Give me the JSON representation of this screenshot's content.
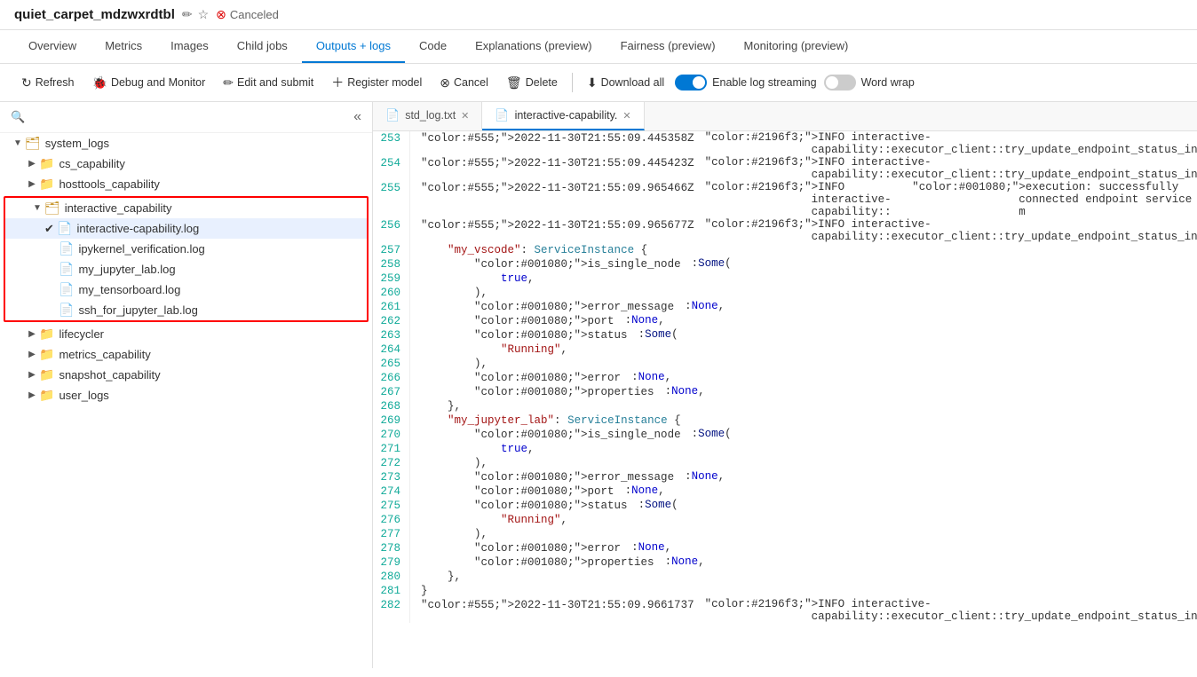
{
  "header": {
    "title": "quiet_carpet_mdzwxrdtbl",
    "status": "Canceled",
    "edit_icon": "✏",
    "star_icon": "☆",
    "cancel_icon": "⊗"
  },
  "nav": {
    "tabs": [
      {
        "label": "Overview",
        "active": false
      },
      {
        "label": "Metrics",
        "active": false
      },
      {
        "label": "Images",
        "active": false
      },
      {
        "label": "Child jobs",
        "active": false
      },
      {
        "label": "Outputs + logs",
        "active": true
      },
      {
        "label": "Code",
        "active": false
      },
      {
        "label": "Explanations (preview)",
        "active": false
      },
      {
        "label": "Fairness (preview)",
        "active": false
      },
      {
        "label": "Monitoring (preview)",
        "active": false
      }
    ]
  },
  "toolbar": {
    "refresh": "Refresh",
    "debug_monitor": "Debug and Monitor",
    "edit_submit": "Edit and submit",
    "register_model": "Register model",
    "cancel": "Cancel",
    "delete": "Delete",
    "download_all": "Download all",
    "enable_log_streaming": "Enable log streaming",
    "word_wrap": "Word wrap",
    "log_streaming_on": true,
    "word_wrap_on": false
  },
  "file_tree": {
    "search_placeholder": "",
    "items": [
      {
        "id": "system_logs",
        "label": "system_logs",
        "type": "folder",
        "depth": 0,
        "expanded": true,
        "chevron": "▼"
      },
      {
        "id": "cs_capability",
        "label": "cs_capability",
        "type": "folder",
        "depth": 1,
        "expanded": false,
        "chevron": "▶"
      },
      {
        "id": "hosttools_capability",
        "label": "hosttools_capability",
        "type": "folder",
        "depth": 1,
        "expanded": false,
        "chevron": "▶"
      },
      {
        "id": "interactive_capability",
        "label": "interactive_capability",
        "type": "folder",
        "depth": 1,
        "expanded": true,
        "chevron": "▼",
        "highlighted": true
      },
      {
        "id": "interactive_capability_log",
        "label": "interactive-capability.log",
        "type": "file",
        "depth": 2,
        "selected": true,
        "highlighted": true
      },
      {
        "id": "ipykernel_verification",
        "label": "ipykernel_verification.log",
        "type": "file",
        "depth": 2,
        "highlighted": true
      },
      {
        "id": "my_jupyter_lab",
        "label": "my_jupyter_lab.log",
        "type": "file",
        "depth": 2,
        "highlighted": true
      },
      {
        "id": "my_tensorboard",
        "label": "my_tensorboard.log",
        "type": "file",
        "depth": 2,
        "highlighted": true
      },
      {
        "id": "ssh_for_jupyter_lab",
        "label": "ssh_for_jupyter_lab.log",
        "type": "file",
        "depth": 2,
        "highlighted": true
      },
      {
        "id": "lifecycler",
        "label": "lifecycler",
        "type": "folder",
        "depth": 1,
        "expanded": false,
        "chevron": "▶"
      },
      {
        "id": "metrics_capability",
        "label": "metrics_capability",
        "type": "folder",
        "depth": 1,
        "expanded": false,
        "chevron": "▶"
      },
      {
        "id": "snapshot_capability",
        "label": "snapshot_capability",
        "type": "folder",
        "depth": 1,
        "expanded": false,
        "chevron": "▶"
      },
      {
        "id": "user_logs",
        "label": "user_logs",
        "type": "folder",
        "depth": 1,
        "expanded": false,
        "chevron": "▶"
      }
    ]
  },
  "tabs": [
    {
      "id": "std_log",
      "label": "std_log.txt",
      "active": false,
      "icon": "📄"
    },
    {
      "id": "interactive",
      "label": "interactive-capability.",
      "active": true,
      "icon": "📄"
    }
  ],
  "log_lines": [
    {
      "num": 253,
      "content": "2022-11-30T21:55:09.445358Z  INFO interactive-capability::executor_client::try_update_endpoint_status_in_cache"
    },
    {
      "num": 254,
      "content": "2022-11-30T21:55:09.445423Z  INFO interactive-capability::executor_client::try_update_endpoint_status_in_cache"
    },
    {
      "num": 255,
      "content": "2022-11-30T21:55:09.965466Z  INFO interactive-capability::execution: successfully connected endpoint service m"
    },
    {
      "num": 256,
      "content": "2022-11-30T21:55:09.965677Z  INFO interactive-capability::executor_client::try_update_endpoint_status_in_cache"
    },
    {
      "num": 257,
      "content": "    \"my_vscode\": ServiceInstance {"
    },
    {
      "num": 258,
      "content": "        is_single_node: Some("
    },
    {
      "num": 259,
      "content": "            true,"
    },
    {
      "num": 260,
      "content": "        ),"
    },
    {
      "num": 261,
      "content": "        error_message: None,"
    },
    {
      "num": 262,
      "content": "        port: None,"
    },
    {
      "num": 263,
      "content": "        status: Some("
    },
    {
      "num": 264,
      "content": "            \"Running\","
    },
    {
      "num": 265,
      "content": "        ),"
    },
    {
      "num": 266,
      "content": "        error: None,"
    },
    {
      "num": 267,
      "content": "        properties: None,"
    },
    {
      "num": 268,
      "content": "    },"
    },
    {
      "num": 269,
      "content": "    \"my_jupyter_lab\": ServiceInstance {"
    },
    {
      "num": 270,
      "content": "        is_single_node: Some("
    },
    {
      "num": 271,
      "content": "            true,"
    },
    {
      "num": 272,
      "content": "        ),"
    },
    {
      "num": 273,
      "content": "        error_message: None,"
    },
    {
      "num": 274,
      "content": "        port: None,"
    },
    {
      "num": 275,
      "content": "        status: Some("
    },
    {
      "num": 276,
      "content": "            \"Running\","
    },
    {
      "num": 277,
      "content": "        ),"
    },
    {
      "num": 278,
      "content": "        error: None,"
    },
    {
      "num": 279,
      "content": "        properties: None,"
    },
    {
      "num": 280,
      "content": "    },"
    },
    {
      "num": 281,
      "content": "}"
    },
    {
      "num": 282,
      "content": "2022-11-30T21:55:09.9661737  INFO interactive-capability::executor_client::try_update_endpoint_status_in_cache"
    }
  ]
}
